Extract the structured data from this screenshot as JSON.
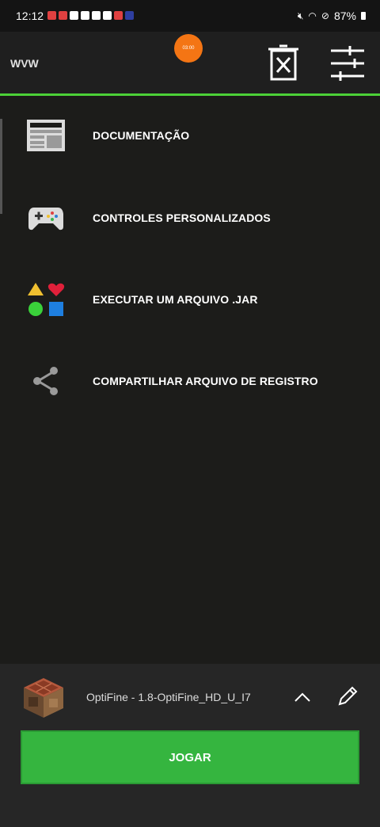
{
  "status_bar": {
    "time": "12:12",
    "battery": "87%"
  },
  "header": {
    "app_name": "WVW",
    "timer": "03:00"
  },
  "menu": {
    "items": [
      {
        "label": "DOCUMENTAÇÃO",
        "icon": "document-icon"
      },
      {
        "label": "CONTROLES PERSONALIZADOS",
        "icon": "gamepad-icon"
      },
      {
        "label": "EXECUTAR UM ARQUIVO .JAR",
        "icon": "shapes-icon"
      },
      {
        "label": "COMPARTILHAR ARQUIVO DE REGISTRO",
        "icon": "share-icon"
      }
    ]
  },
  "bottom": {
    "version_name": "OptiFine - 1.8-OptiFine_HD_U_I7",
    "play_label": "JOGAR"
  },
  "colors": {
    "accent": "#4cd137",
    "play": "#35b53f",
    "timer": "#f47514"
  }
}
